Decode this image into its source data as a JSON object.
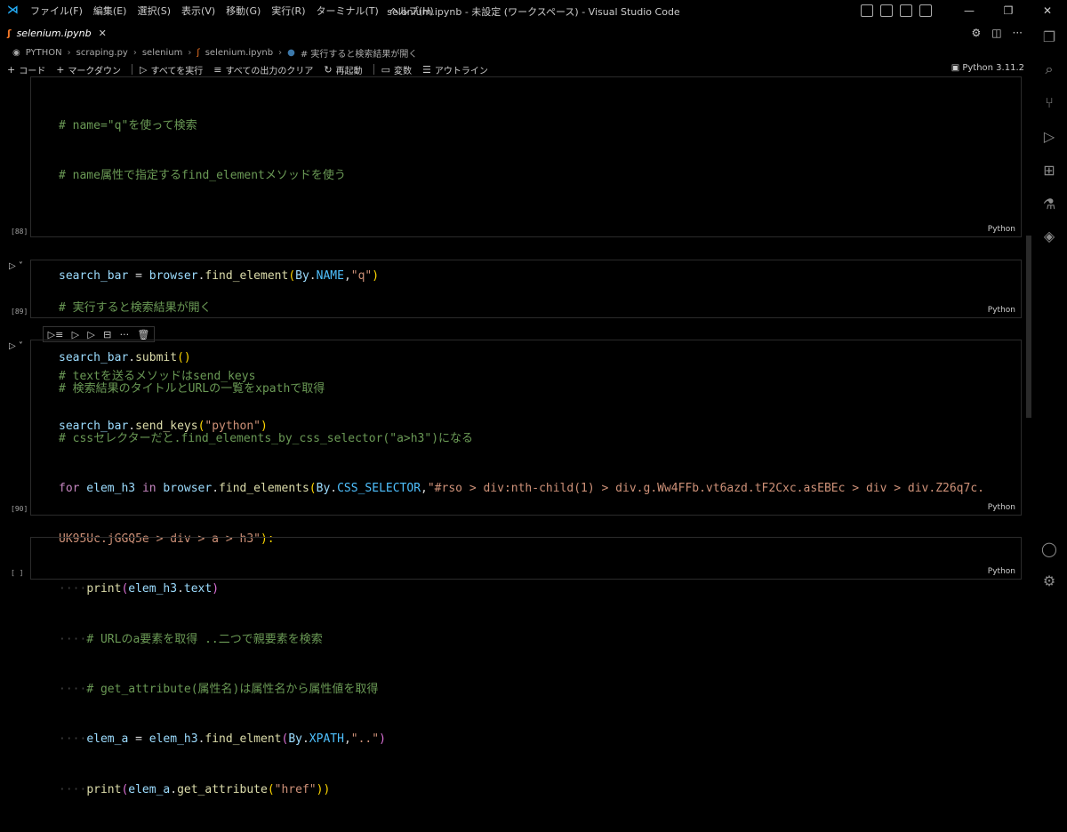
{
  "titlebar": {
    "menus": [
      "ファイル(F)",
      "編集(E)",
      "選択(S)",
      "表示(V)",
      "移動(G)",
      "実行(R)",
      "ターミナル(T)",
      "ヘルプ(H)"
    ],
    "window_title": "selenium.ipynb - 未設定 (ワークスペース) - Visual Studio Code"
  },
  "tab": {
    "label": "selenium.ipynb",
    "close": "✕"
  },
  "breadcrumb": [
    "PYTHON",
    "scraping.py",
    "selenium",
    "selenium.ipynb",
    "# 実行すると検索結果が開く"
  ],
  "toolbar": {
    "code": "コード",
    "markdown": "マークダウン",
    "run_all": "すべてを実行",
    "clear_outputs": "すべての出力のクリア",
    "restart": "再起動",
    "variables": "変数",
    "outline": "アウトライン",
    "kernel": "Python 3.11.2"
  },
  "cells": [
    {
      "number": "[88]",
      "lang": "Python"
    },
    {
      "number": "[89]",
      "lang": "Python"
    },
    {
      "number": "[90]",
      "lang": "Python"
    },
    {
      "number": "[ ]",
      "lang": "Python"
    }
  ],
  "code": {
    "c88": {
      "l1": "# name=\"q\"を使って検索",
      "l2": "# name属性で指定するfind_elementメソッドを使う",
      "l3a": "search_bar",
      "l3b": " = ",
      "l3c": "browser",
      "l3d": ".",
      "l3e": "find_element",
      "l3f": "(",
      "l3g": "By",
      "l3h": ".",
      "l3i": "NAME",
      "l3j": ",",
      "l3k": "\"q\"",
      "l3l": ")",
      "l4": "# textを送るメソッドはsend_keys",
      "l5a": "search_bar",
      "l5b": ".",
      "l5c": "send_keys",
      "l5d": "(",
      "l5e": "\"python\"",
      "l5f": ")"
    },
    "c89": {
      "l1": "# 実行すると検索結果が開く",
      "l2a": "search_bar",
      "l2b": ".",
      "l2c": "submit",
      "l2d": "()"
    },
    "c90": {
      "l1": "# 検索結果のタイトルとURLの一覧をxpathで取得",
      "l2": "# cssセレクターだと.find_elements_by_css_selector(\"a>h3\")になる",
      "l3a": "for",
      "l3b": " elem_h3 ",
      "l3c": "in",
      "l3d": " browser",
      "l3e": ".",
      "l3f": "find_elements",
      "l3g": "(",
      "l3h": "By",
      "l3i": ".",
      "l3j": "CSS_SELECTOR",
      "l3k": ",",
      "l3l": "\"#rso > div:nth-child(1) > div.g.Ww4FFb.vt6azd.tF2Cxc.asEBEc > div > div.Z26q7c.",
      "l4a": "UK95Uc.jGGQ5e > div > a > h3\"",
      "l4b": "):",
      "l5a": "print",
      "l5b": "(",
      "l5c": "elem_h3",
      "l5d": ".",
      "l5e": "text",
      "l5f": ")",
      "l6": "# URLのa要素を取得 ..二つで親要素を検索",
      "l7": "# get_attribute(属性名)は属性名から属性値を取得",
      "l8a": "elem_a",
      "l8b": " = ",
      "l8c": "elem_h3",
      "l8d": ".",
      "l8e": "find_elment",
      "l8f": "(",
      "l8g": "By",
      "l8h": ".",
      "l8i": "XPATH",
      "l8j": ",",
      "l8k": "\"..\"",
      "l8l": ")",
      "l9a": "print",
      "l9b": "(",
      "l9c": "elem_a",
      "l9d": ".",
      "l9e": "get_attribute",
      "l9f": "(",
      "l9g": "\"href\"",
      "l9h": "))"
    }
  },
  "colors": {
    "comment": "#6a9955",
    "keyword": "#c586c0",
    "variable": "#9cdcfe",
    "function": "#dcdcaa",
    "string": "#ce9178",
    "constant": "#4fc1ff"
  }
}
